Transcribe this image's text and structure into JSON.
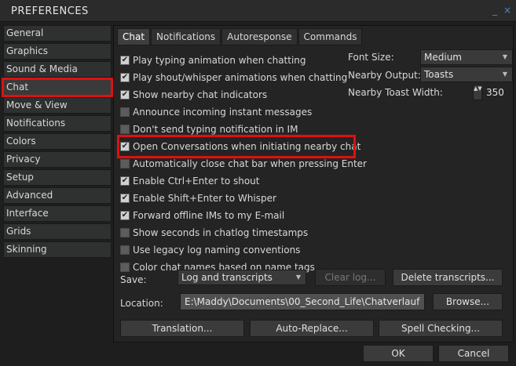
{
  "window": {
    "title": "PREFERENCES",
    "minimize_glyph": "_",
    "close_glyph": "×"
  },
  "sidebar": {
    "items": [
      {
        "label": "General"
      },
      {
        "label": "Graphics"
      },
      {
        "label": "Sound & Media"
      },
      {
        "label": "Chat"
      },
      {
        "label": "Move & View"
      },
      {
        "label": "Notifications"
      },
      {
        "label": "Colors"
      },
      {
        "label": "Privacy"
      },
      {
        "label": "Setup"
      },
      {
        "label": "Advanced"
      },
      {
        "label": "Interface"
      },
      {
        "label": "Grids"
      },
      {
        "label": "Skinning"
      }
    ],
    "active": "Chat"
  },
  "tabs": [
    {
      "label": "Chat"
    },
    {
      "label": "Notifications"
    },
    {
      "label": "Autoresponse"
    },
    {
      "label": "Commands"
    }
  ],
  "checkboxes": [
    {
      "label": "Play typing animation when chatting",
      "checked": true
    },
    {
      "label": "Play shout/whisper animations when chatting",
      "checked": true
    },
    {
      "label": "Show nearby chat indicators",
      "checked": true
    },
    {
      "label": "Announce incoming instant messages",
      "checked": false
    },
    {
      "label": "Don't send typing notification in IM",
      "checked": false
    },
    {
      "label": "Open Conversations when initiating nearby chat",
      "checked": true
    },
    {
      "label": "Automatically close chat bar when pressing Enter",
      "checked": false
    },
    {
      "label": "Enable Ctrl+Enter to shout",
      "checked": true
    },
    {
      "label": "Enable Shift+Enter to Whisper",
      "checked": true
    },
    {
      "label": "Forward offline IMs to my E-mail",
      "checked": true
    },
    {
      "label": "Show seconds in chatlog timestamps",
      "checked": false
    },
    {
      "label": "Use legacy log naming conventions",
      "checked": false
    },
    {
      "label": "Color chat names based on name tags",
      "checked": false
    }
  ],
  "check_glyph": "✔",
  "right_settings": {
    "font_size_label": "Font Size:",
    "font_size_value": "Medium",
    "nearby_output_label": "Nearby Output:",
    "nearby_output_value": "Toasts",
    "toast_width_label": "Nearby Toast Width:",
    "toast_width_value": "350",
    "spinner_glyphs": "▲▼"
  },
  "save": {
    "label": "Save:",
    "value": "Log and transcripts",
    "clear_log": "Clear log...",
    "delete_transcripts": "Delete transcripts..."
  },
  "location": {
    "label": "Location:",
    "value": "E:\\Maddy\\Documents\\00_Second_Life\\Chatverlauf",
    "browse": "Browse..."
  },
  "actions": {
    "translation": "Translation...",
    "auto_replace": "Auto-Replace...",
    "spell_checking": "Spell Checking..."
  },
  "footer": {
    "ok": "OK",
    "cancel": "Cancel"
  },
  "colors": {
    "highlight": "#e01010",
    "accent": "#3a8fd6"
  }
}
